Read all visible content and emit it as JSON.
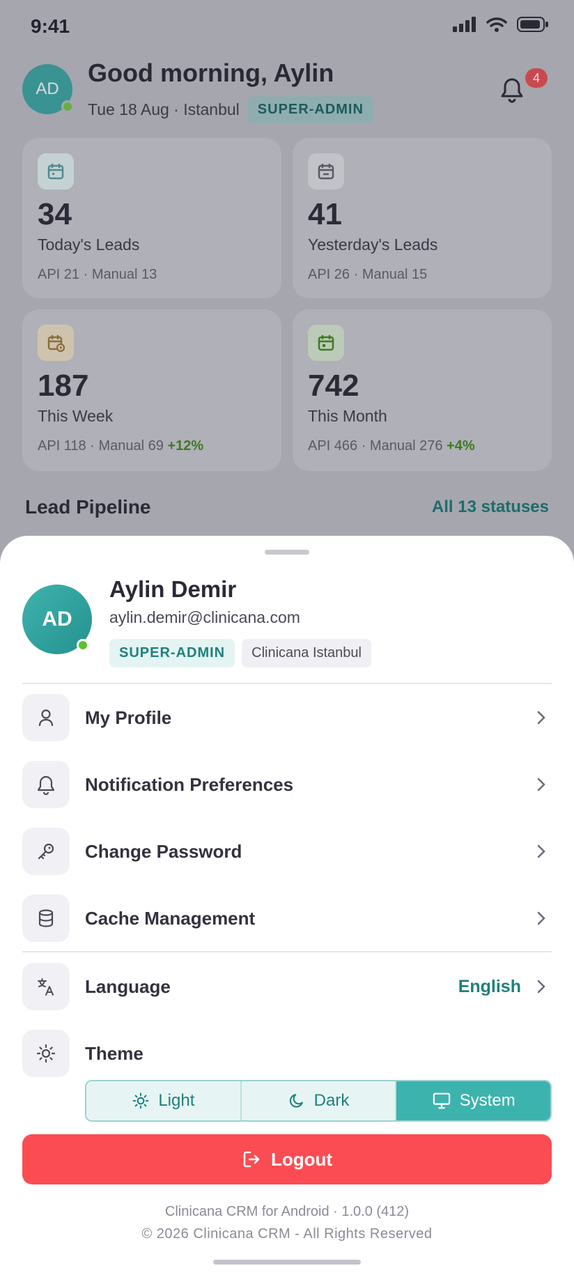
{
  "status": {
    "time": "9:41"
  },
  "header": {
    "initials": "AD",
    "greeting": "Good morning, Aylin",
    "date_location": "Tue 18 Aug · Istanbul",
    "role": "SUPER-ADMIN",
    "notification_count": "4"
  },
  "stats": [
    {
      "value": "34",
      "label": "Today's Leads",
      "meta": "API 21 · Manual 13",
      "delta": "",
      "icon": "calendar-icon",
      "color": "#8fb0b0"
    },
    {
      "value": "41",
      "label": "Yesterday's Leads",
      "meta": "API 26 · Manual 15",
      "delta": "",
      "icon": "calendar-minus-icon",
      "color": "#9b9ba4"
    },
    {
      "value": "187",
      "label": "This Week",
      "meta": "API 118 · Manual 69 ",
      "delta": "+12%",
      "icon": "calendar-clock-icon",
      "color": "#b4a58a"
    },
    {
      "value": "742",
      "label": "This Month",
      "meta": "API 466 · Manual 276 ",
      "delta": "+4%",
      "icon": "calendar-check-icon",
      "color": "#97ad90"
    }
  ],
  "pipeline": {
    "title": "Lead Pipeline",
    "link": "All 13 statuses"
  },
  "profile": {
    "initials": "AD",
    "name": "Aylin Demir",
    "email": "aylin.demir@clinicana.com",
    "role": "SUPER-ADMIN",
    "clinic": "Clinicana Istanbul"
  },
  "menu": {
    "my_profile": "My Profile",
    "notification_preferences": "Notification Preferences",
    "change_password": "Change Password",
    "cache_management": "Cache Management",
    "language": "Language",
    "language_value": "English",
    "theme": "Theme"
  },
  "theme_options": {
    "light": "Light",
    "dark": "Dark",
    "system": "System",
    "selected": "System"
  },
  "logout": "Logout",
  "footer": {
    "version": "Clinicana CRM for Android · 1.0.0 (412)",
    "copyright": "© 2026 Clinicana CRM - All Rights Reserved"
  },
  "colors": {
    "accent": "#3db3ad",
    "danger": "#fc4c53",
    "online": "#5dc22c"
  }
}
